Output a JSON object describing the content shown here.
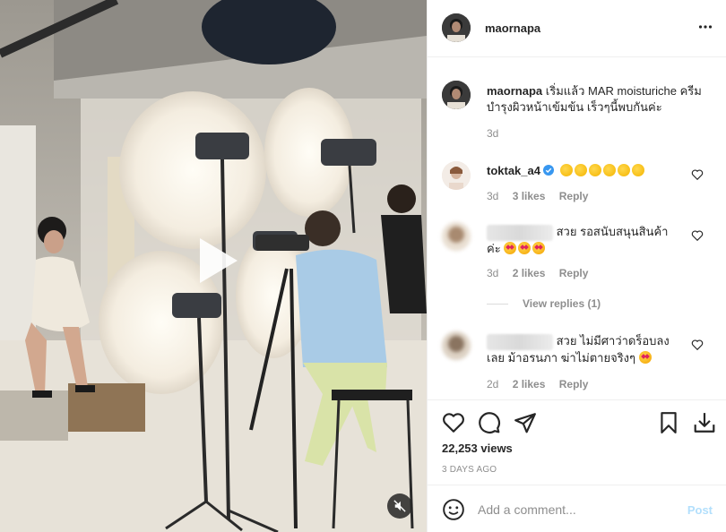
{
  "post": {
    "username": "maornapa",
    "caption_text": "เริ่มแล้ว MAR moisturiche ครีมบำรุงผิวหน้าเข้มข้น เร็วๆนี้พบกันค่ะ",
    "caption_age": "3d"
  },
  "comments": [
    {
      "username": "toktak_a4",
      "verified": true,
      "text": "",
      "emoji_count": 6,
      "emoji": "clap",
      "age": "3d",
      "likes": "3 likes",
      "reply": "Reply"
    },
    {
      "username": "",
      "name_blurred": true,
      "text": "สวย รอสนับสนุนสินค้าค่ะ",
      "emoji_count": 3,
      "emoji": "star-struck",
      "age": "3d",
      "likes": "2 likes",
      "reply": "Reply",
      "view_replies": "View replies (1)"
    },
    {
      "username": "",
      "name_blurred": true,
      "text": "สวย ไม่มีศาว่าดร็อบลงเลย ม้าอรนภา ฆ่าไม่ตายจริงๆ",
      "emoji_count": 1,
      "emoji": "star-struck",
      "age": "2d",
      "likes": "2 likes",
      "reply": "Reply"
    }
  ],
  "stats": {
    "views": "22,253 views",
    "time_ago": "3 DAYS AGO"
  },
  "add_comment": {
    "placeholder": "Add a comment...",
    "post_label": "Post"
  },
  "colors": {
    "post_button_disabled": "#b2dffc",
    "verified": "#3897f0",
    "secondary_text": "#8e8e8e",
    "primary_text": "#262626"
  },
  "icons": [
    "play-icon",
    "mute-icon",
    "more-icon",
    "heart-icon",
    "comment-icon",
    "share-icon",
    "bookmark-icon",
    "download-icon",
    "emoji-icon",
    "verified-icon"
  ]
}
